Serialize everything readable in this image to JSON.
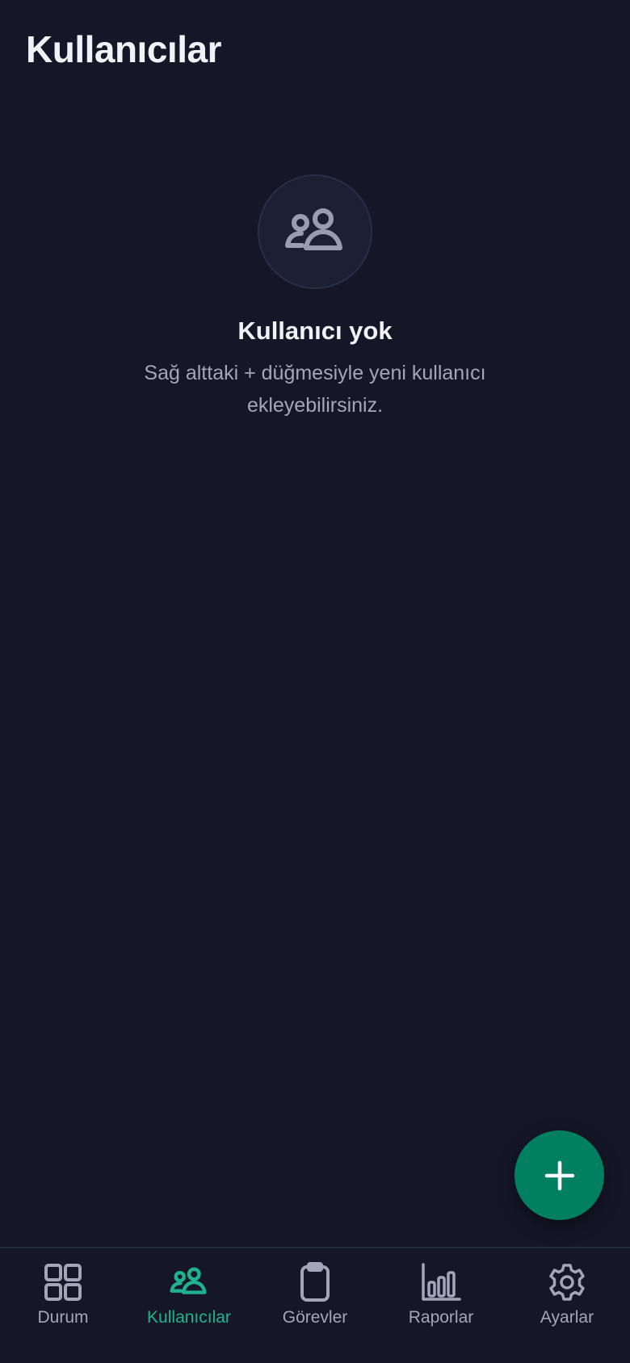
{
  "header": {
    "title": "Kullanıcılar"
  },
  "empty_state": {
    "icon": "users-icon",
    "title": "Kullanıcı yok",
    "description": "Sağ alttaki + düğmesiyle yeni kullanıcı ekleyebilirsiniz."
  },
  "fab": {
    "icon": "plus-icon",
    "color": "#008060"
  },
  "tabs": [
    {
      "label": "Durum",
      "icon": "dashboard-grid-icon",
      "active": false
    },
    {
      "label": "Kullanıcılar",
      "icon": "users-icon",
      "active": true
    },
    {
      "label": "Görevler",
      "icon": "clipboard-icon",
      "active": false
    },
    {
      "label": "Raporlar",
      "icon": "bar-chart-icon",
      "active": false
    },
    {
      "label": "Ayarlar",
      "icon": "gear-icon",
      "active": false
    }
  ],
  "colors": {
    "background": "#151728",
    "accent": "#1eb38c",
    "inactive": "#a3a6b9"
  }
}
